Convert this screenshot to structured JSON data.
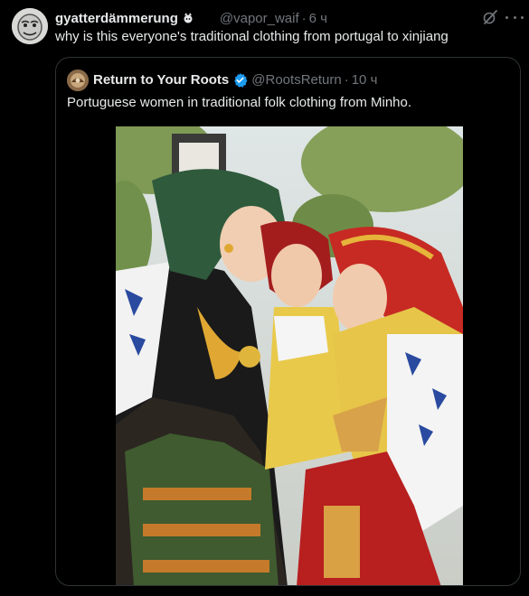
{
  "post": {
    "display_name": "gyatterdämmerung",
    "badge_icon": "tiny-creature-icon",
    "handle": "@vapor_waif",
    "separator": "·",
    "time": "6 ч",
    "text": "why is this everyone's traditional clothing from portugal to xinjiang",
    "grok_icon": "grok-icon",
    "more_icon": "more-icon"
  },
  "quote": {
    "display_name": "Return to Your Roots",
    "verified_icon": "verified-badge-icon",
    "handle": "@RootsReturn",
    "separator": "·",
    "time": "10 ч",
    "text": "Portuguese women in traditional folk clothing from Minho.",
    "photo_icon": "photo-image"
  },
  "colors": {
    "background": "#000000",
    "text": "#e7e9ea",
    "secondary": "#71767b",
    "border": "#2f3336",
    "verified": "#1d9bf0"
  }
}
